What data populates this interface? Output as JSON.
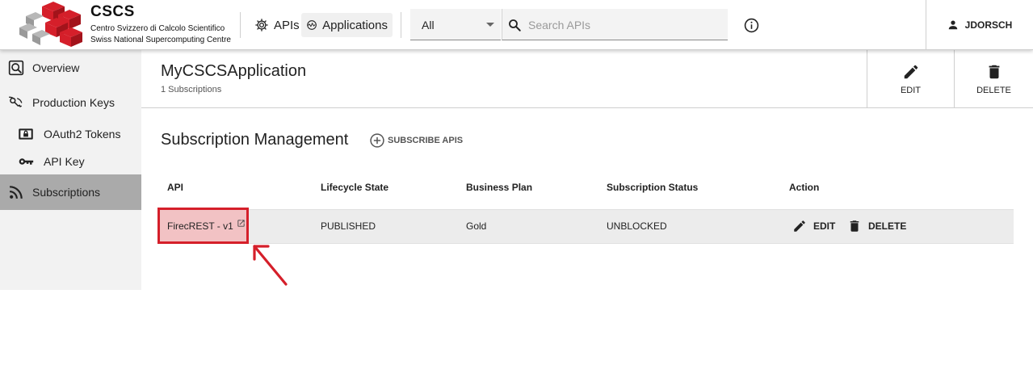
{
  "brand": {
    "title": "CSCS",
    "line1": "Centro Svizzero di Calcolo Scientifico",
    "line2": "Swiss National Supercomputing Centre",
    "logo_color": "#d51f2a"
  },
  "nav": {
    "apis_label": "APIs",
    "applications_label": "Applications"
  },
  "search": {
    "scope_value": "All",
    "placeholder": "Search APIs"
  },
  "user": {
    "name": "JDORSCH"
  },
  "sidebar": {
    "items": [
      {
        "label": "Overview",
        "icon": "overview-icon"
      },
      {
        "label": "Production Keys",
        "icon": "keys-icon"
      },
      {
        "label": "OAuth2 Tokens",
        "icon": "lock-icon"
      },
      {
        "label": "API Key",
        "icon": "key-icon"
      },
      {
        "label": "Subscriptions",
        "icon": "rss-icon",
        "active": true
      }
    ]
  },
  "application": {
    "title": "MyCSCSApplication",
    "subtitle": "1 Subscriptions",
    "edit_label": "EDIT",
    "delete_label": "DELETE"
  },
  "subscriptions": {
    "section_title": "Subscription Management",
    "subscribe_label": "SUBSCRIBE APIS",
    "columns": [
      "API",
      "Lifecycle State",
      "Business Plan",
      "Subscription Status",
      "Action"
    ],
    "rows": [
      {
        "api": "FirecREST - v1",
        "lifecycle": "PUBLISHED",
        "plan": "Gold",
        "status": "UNBLOCKED",
        "edit_label": "EDIT",
        "delete_label": "DELETE"
      }
    ]
  },
  "annotation": {
    "highlight_color": "#d51f2a"
  }
}
